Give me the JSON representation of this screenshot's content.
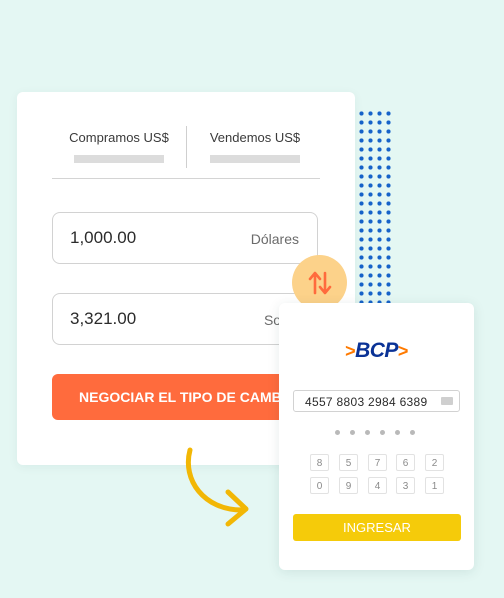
{
  "exchange": {
    "buy_label": "Compramos US$",
    "sell_label": "Vendemos US$",
    "amount_usd": "1,000.00",
    "currency_usd": "Dólares",
    "amount_pen": "3,321.00",
    "currency_pen": "Soles",
    "cta_label": "NEGOCIAR EL TIPO DE CAMBIO"
  },
  "bank": {
    "brand": "BCP",
    "card_number": "4557 8803 2984 6389",
    "keypad_row1": [
      "8",
      "5",
      "7",
      "6",
      "2"
    ],
    "keypad_row2": [
      "0",
      "9",
      "4",
      "3",
      "1"
    ],
    "login_label": "INGRESAR"
  },
  "colors": {
    "background": "#e4f7f3",
    "cta": "#ff6b3d",
    "swap_circle": "#fcd28a",
    "bcp_blue": "#0a3296",
    "bcp_orange": "#ff7a00",
    "login": "#f5cb0a",
    "arrow": "#f2b705",
    "dots": "#1763c9"
  },
  "icons": {
    "swap": "swap-vertical-arrows-icon",
    "card": "credit-card-icon",
    "arrow": "curved-arrow-icon"
  }
}
